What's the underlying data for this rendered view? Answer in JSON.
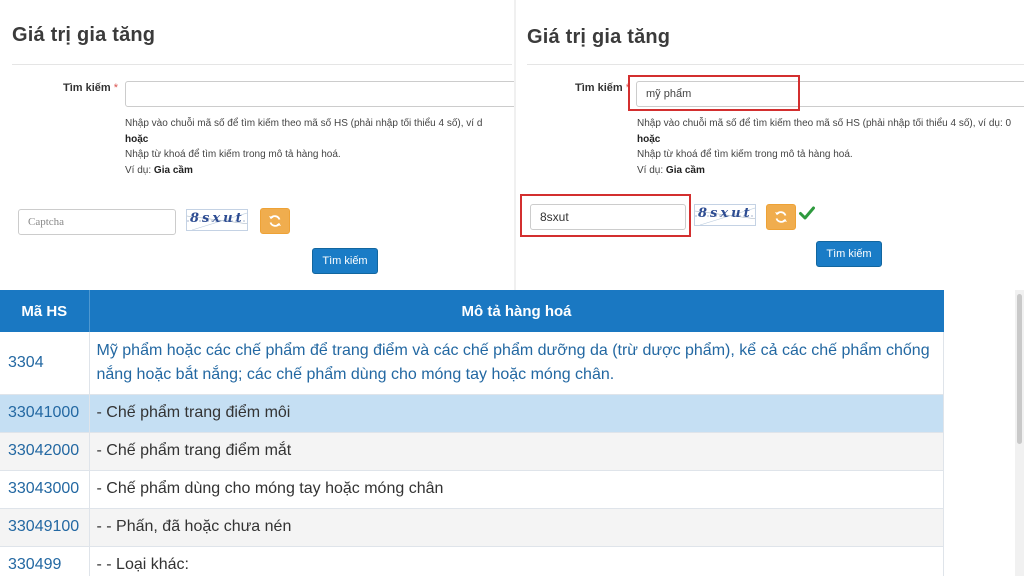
{
  "colors": {
    "accent_blue": "#1a78c2",
    "link_blue": "#2368a2",
    "highlight_row": "#c5dff3",
    "refresh_orange": "#f0ad4e",
    "highlight_box_red": "#d32f2f",
    "check_green": "#2e9a3e"
  },
  "left_panel": {
    "title": "Giá trị gia tăng",
    "search_label": "Tìm kiếm",
    "required_mark": "*",
    "search_value": "",
    "help_line1": "Nhập vào chuỗi mã số để tìm kiếm theo mã số HS (phải nhập tối thiểu 4 số), ví d",
    "help_or": "hoặc",
    "help_line2": "Nhập từ khoá để tìm kiếm trong mô tả hàng hoá.",
    "help_example_prefix": "Ví dụ:",
    "help_example_value": "Gia cầm",
    "captcha_placeholder": "Captcha",
    "captcha_value": "",
    "captcha_image_text": "8sxut",
    "refresh_icon": "refresh-icon",
    "search_button": "Tìm kiếm"
  },
  "right_panel": {
    "title": "Giá trị gia tăng",
    "search_label": "Tìm kiếm",
    "required_mark": "*",
    "search_value": "mỹ phẩm",
    "help_line1": "Nhập vào chuỗi mã số để tìm kiếm theo mã số HS (phải nhập tối thiểu 4 số), ví dụ: 0",
    "help_or": "hoặc",
    "help_line2": "Nhập từ khoá để tìm kiếm trong mô tả hàng hoá.",
    "help_example_prefix": "Ví dụ:",
    "help_example_value": "Gia cầm",
    "captcha_placeholder": "Captcha",
    "captcha_value": "8sxut",
    "captcha_image_text": "8sxut",
    "refresh_icon": "refresh-icon",
    "check_icon": "check-icon",
    "search_button": "Tìm kiếm"
  },
  "table": {
    "headers": [
      "Mã HS",
      "Mô tả hàng hoá"
    ],
    "rows": [
      {
        "code": "3304",
        "desc": "Mỹ phẩm hoặc các chế phẩm để trang điểm và các chế phẩm dưỡng da (trừ dược phẩm), kể cả các chế phẩm chống nắng hoặc bắt nắng; các chế phẩm dùng cho móng tay hoặc móng chân."
      },
      {
        "code": "33041000",
        "desc": "- Chế phẩm trang điểm môi"
      },
      {
        "code": "33042000",
        "desc": "- Chế phẩm trang điểm mắt"
      },
      {
        "code": "33043000",
        "desc": "- Chế phẩm dùng cho móng tay hoặc móng chân"
      },
      {
        "code": "33049100",
        "desc": "- - Phấn, đã hoặc chưa nén"
      },
      {
        "code": "330499",
        "desc": "- - Loại khác:"
      }
    ]
  }
}
